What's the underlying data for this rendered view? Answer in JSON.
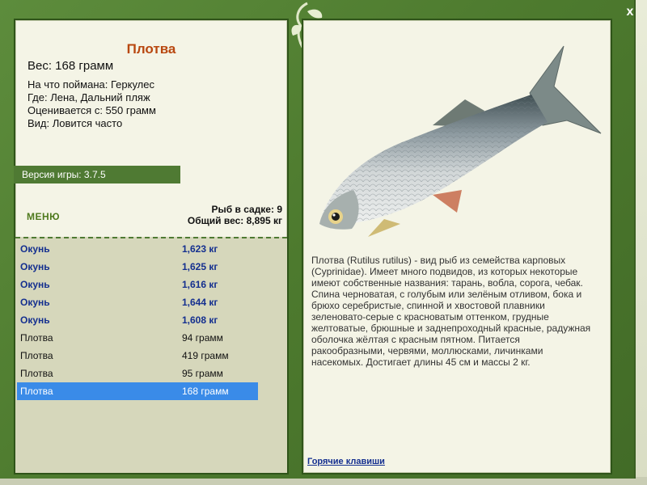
{
  "window": {
    "close_label": "x"
  },
  "fish": {
    "title": "Плотва",
    "weight": "Вес: 168 грамм",
    "bait": "На что поймана: Геркулес",
    "location": "Где: Лена, Дальний пляж",
    "price": "Оценивается с: 550 грамм",
    "kind": "Вид: Ловится часто"
  },
  "version": "Версия игры: 3.7.5",
  "menu_label": "МЕНЮ",
  "cage": {
    "count": "Рыб в садке: 9",
    "total": "Общий вес: 8,895 кг"
  },
  "catch_list": [
    {
      "name": "Окунь",
      "weight": "1,623 кг"
    },
    {
      "name": "Окунь",
      "weight": "1,625 кг"
    },
    {
      "name": "Окунь",
      "weight": "1,616 кг"
    },
    {
      "name": "Окунь",
      "weight": "1,644 кг"
    },
    {
      "name": "Окунь",
      "weight": "1,608 кг"
    },
    {
      "name": "Плотва",
      "weight": "94 грамм"
    },
    {
      "name": "Плотва",
      "weight": "419 грамм"
    },
    {
      "name": "Плотва",
      "weight": "95 грамм"
    },
    {
      "name": "Плотва",
      "weight": "168 грамм"
    }
  ],
  "description": "Плотва (Rutilus rutilus) - вид рыб из семейства карповых (Cyprinidae). Имеет много подвидов, из которых некоторые имеют собственные названия: тарань, вобла, сорога, чебак. Спина черноватая, с голубым или зелёным отливом, бока и брюхо серебристые, спинной и хвостовой плавники зеленовато-серые с красноватым оттенком, грудные желтоватые, брюшные и заднепроходный красные, радужная оболочка жёлтая с красным пятном. Питается ракообразными, червями, моллюсками, личинками насекомых. Достигает длины 45 см и массы 2 кг.",
  "hotkeys_label": "Горячие клавиши",
  "colors": {
    "frame": "#4f7a33",
    "panel": "#f4f4e6",
    "title": "#b8470f",
    "trophy_text": "#142f8f",
    "selected_row": "#3a8be8"
  }
}
